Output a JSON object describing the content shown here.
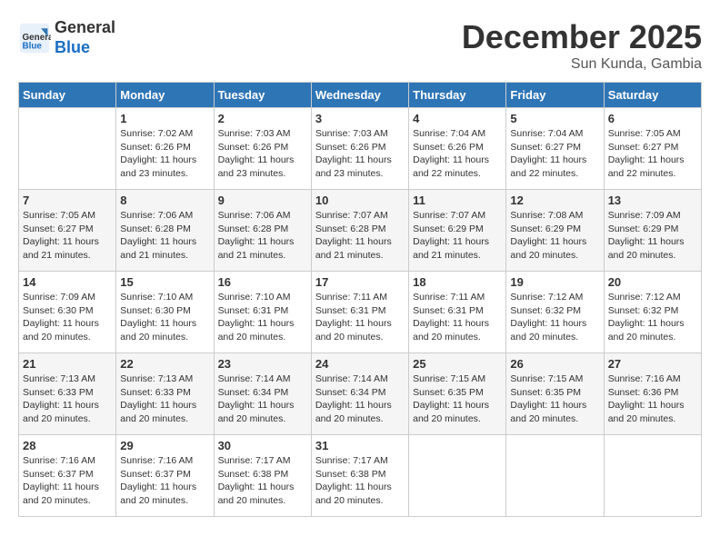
{
  "header": {
    "logo_line1": "General",
    "logo_line2": "Blue",
    "month": "December 2025",
    "location": "Sun Kunda, Gambia"
  },
  "days_of_week": [
    "Sunday",
    "Monday",
    "Tuesday",
    "Wednesday",
    "Thursday",
    "Friday",
    "Saturday"
  ],
  "weeks": [
    [
      {
        "day": "",
        "info": ""
      },
      {
        "day": "1",
        "info": "Sunrise: 7:02 AM\nSunset: 6:26 PM\nDaylight: 11 hours\nand 23 minutes."
      },
      {
        "day": "2",
        "info": "Sunrise: 7:03 AM\nSunset: 6:26 PM\nDaylight: 11 hours\nand 23 minutes."
      },
      {
        "day": "3",
        "info": "Sunrise: 7:03 AM\nSunset: 6:26 PM\nDaylight: 11 hours\nand 23 minutes."
      },
      {
        "day": "4",
        "info": "Sunrise: 7:04 AM\nSunset: 6:26 PM\nDaylight: 11 hours\nand 22 minutes."
      },
      {
        "day": "5",
        "info": "Sunrise: 7:04 AM\nSunset: 6:27 PM\nDaylight: 11 hours\nand 22 minutes."
      },
      {
        "day": "6",
        "info": "Sunrise: 7:05 AM\nSunset: 6:27 PM\nDaylight: 11 hours\nand 22 minutes."
      }
    ],
    [
      {
        "day": "7",
        "info": "Sunrise: 7:05 AM\nSunset: 6:27 PM\nDaylight: 11 hours\nand 21 minutes."
      },
      {
        "day": "8",
        "info": "Sunrise: 7:06 AM\nSunset: 6:28 PM\nDaylight: 11 hours\nand 21 minutes."
      },
      {
        "day": "9",
        "info": "Sunrise: 7:06 AM\nSunset: 6:28 PM\nDaylight: 11 hours\nand 21 minutes."
      },
      {
        "day": "10",
        "info": "Sunrise: 7:07 AM\nSunset: 6:28 PM\nDaylight: 11 hours\nand 21 minutes."
      },
      {
        "day": "11",
        "info": "Sunrise: 7:07 AM\nSunset: 6:29 PM\nDaylight: 11 hours\nand 21 minutes."
      },
      {
        "day": "12",
        "info": "Sunrise: 7:08 AM\nSunset: 6:29 PM\nDaylight: 11 hours\nand 20 minutes."
      },
      {
        "day": "13",
        "info": "Sunrise: 7:09 AM\nSunset: 6:29 PM\nDaylight: 11 hours\nand 20 minutes."
      }
    ],
    [
      {
        "day": "14",
        "info": "Sunrise: 7:09 AM\nSunset: 6:30 PM\nDaylight: 11 hours\nand 20 minutes."
      },
      {
        "day": "15",
        "info": "Sunrise: 7:10 AM\nSunset: 6:30 PM\nDaylight: 11 hours\nand 20 minutes."
      },
      {
        "day": "16",
        "info": "Sunrise: 7:10 AM\nSunset: 6:31 PM\nDaylight: 11 hours\nand 20 minutes."
      },
      {
        "day": "17",
        "info": "Sunrise: 7:11 AM\nSunset: 6:31 PM\nDaylight: 11 hours\nand 20 minutes."
      },
      {
        "day": "18",
        "info": "Sunrise: 7:11 AM\nSunset: 6:31 PM\nDaylight: 11 hours\nand 20 minutes."
      },
      {
        "day": "19",
        "info": "Sunrise: 7:12 AM\nSunset: 6:32 PM\nDaylight: 11 hours\nand 20 minutes."
      },
      {
        "day": "20",
        "info": "Sunrise: 7:12 AM\nSunset: 6:32 PM\nDaylight: 11 hours\nand 20 minutes."
      }
    ],
    [
      {
        "day": "21",
        "info": "Sunrise: 7:13 AM\nSunset: 6:33 PM\nDaylight: 11 hours\nand 20 minutes."
      },
      {
        "day": "22",
        "info": "Sunrise: 7:13 AM\nSunset: 6:33 PM\nDaylight: 11 hours\nand 20 minutes."
      },
      {
        "day": "23",
        "info": "Sunrise: 7:14 AM\nSunset: 6:34 PM\nDaylight: 11 hours\nand 20 minutes."
      },
      {
        "day": "24",
        "info": "Sunrise: 7:14 AM\nSunset: 6:34 PM\nDaylight: 11 hours\nand 20 minutes."
      },
      {
        "day": "25",
        "info": "Sunrise: 7:15 AM\nSunset: 6:35 PM\nDaylight: 11 hours\nand 20 minutes."
      },
      {
        "day": "26",
        "info": "Sunrise: 7:15 AM\nSunset: 6:35 PM\nDaylight: 11 hours\nand 20 minutes."
      },
      {
        "day": "27",
        "info": "Sunrise: 7:16 AM\nSunset: 6:36 PM\nDaylight: 11 hours\nand 20 minutes."
      }
    ],
    [
      {
        "day": "28",
        "info": "Sunrise: 7:16 AM\nSunset: 6:37 PM\nDaylight: 11 hours\nand 20 minutes."
      },
      {
        "day": "29",
        "info": "Sunrise: 7:16 AM\nSunset: 6:37 PM\nDaylight: 11 hours\nand 20 minutes."
      },
      {
        "day": "30",
        "info": "Sunrise: 7:17 AM\nSunset: 6:38 PM\nDaylight: 11 hours\nand 20 minutes."
      },
      {
        "day": "31",
        "info": "Sunrise: 7:17 AM\nSunset: 6:38 PM\nDaylight: 11 hours\nand 20 minutes."
      },
      {
        "day": "",
        "info": ""
      },
      {
        "day": "",
        "info": ""
      },
      {
        "day": "",
        "info": ""
      }
    ]
  ]
}
